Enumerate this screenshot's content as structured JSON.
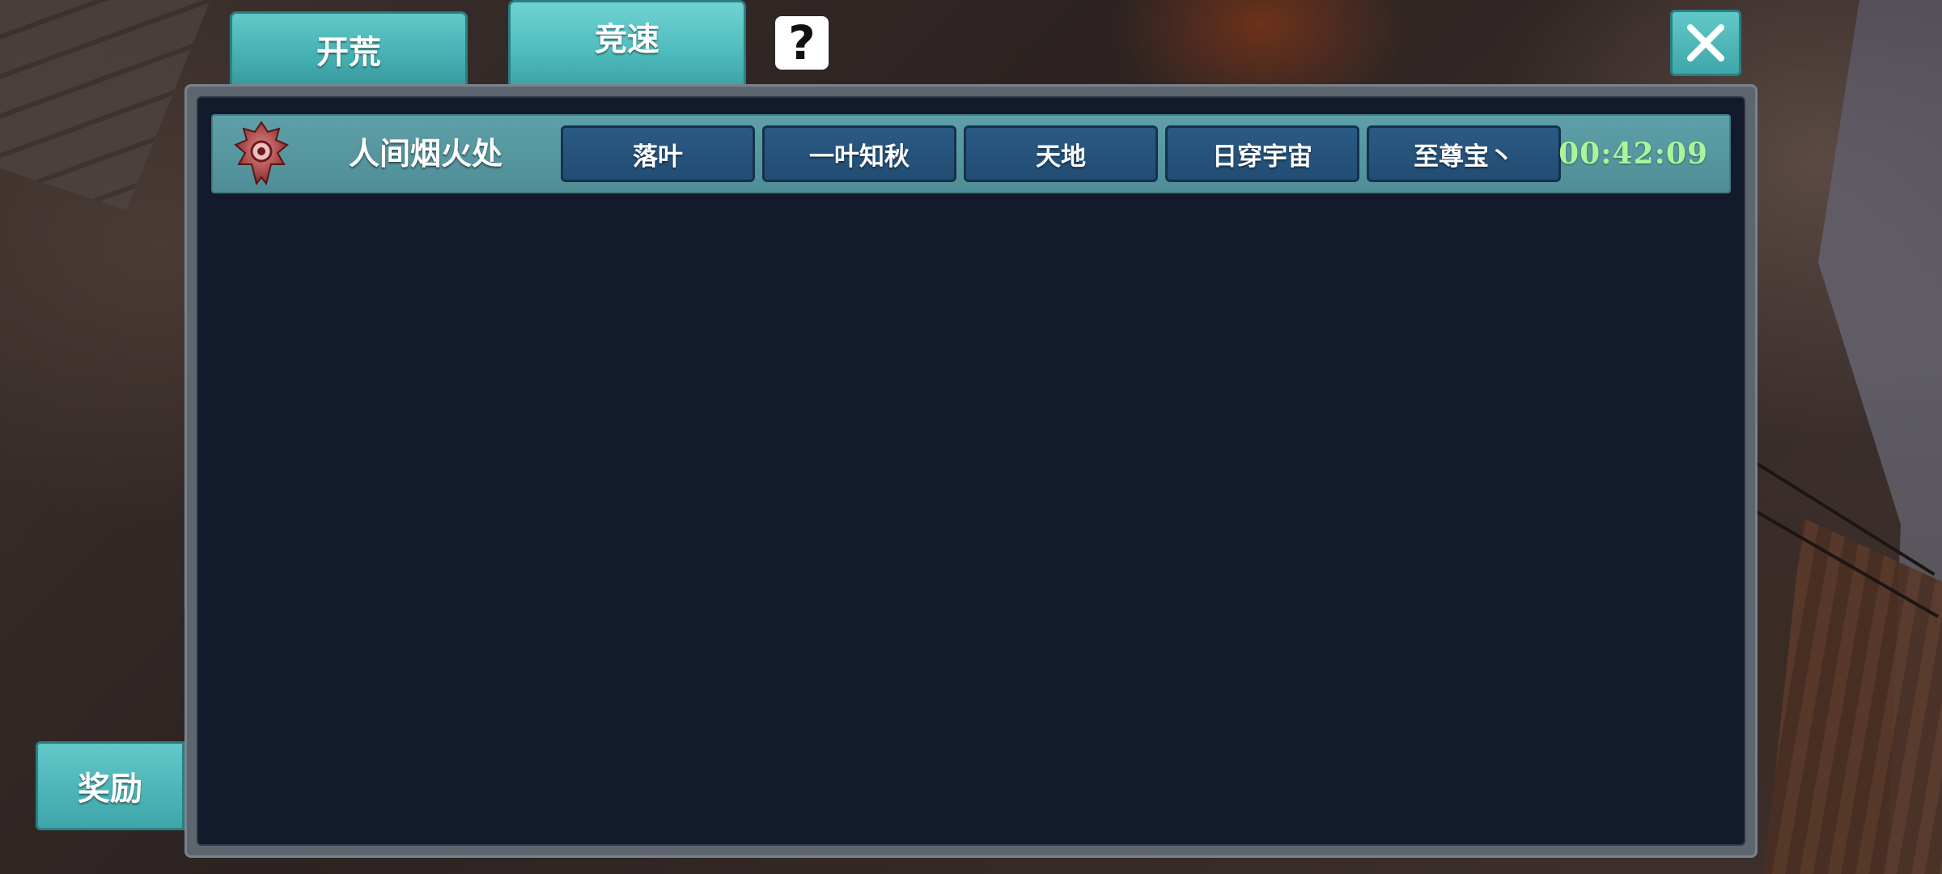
{
  "tabs": [
    {
      "label": "开荒"
    },
    {
      "label": "竞速"
    }
  ],
  "help_icon": "question-mark-icon",
  "close_icon": "close-x-icon",
  "race_list": [
    {
      "guild_emblem": "guild-emblem-icon",
      "guild_name": "人间烟火处",
      "members": [
        "落叶",
        "一叶知秋",
        "天地",
        "日穿宇宙",
        "至尊宝丶"
      ],
      "time": "00:42:09"
    }
  ],
  "reward_button": "奖励",
  "colors": {
    "tab_teal": "#4fbcbd",
    "panel_bg": "#131a2b",
    "row_bg": "#5fa0a8",
    "member_btn": "#2a5a84",
    "timer_green": "#a8f59a"
  }
}
